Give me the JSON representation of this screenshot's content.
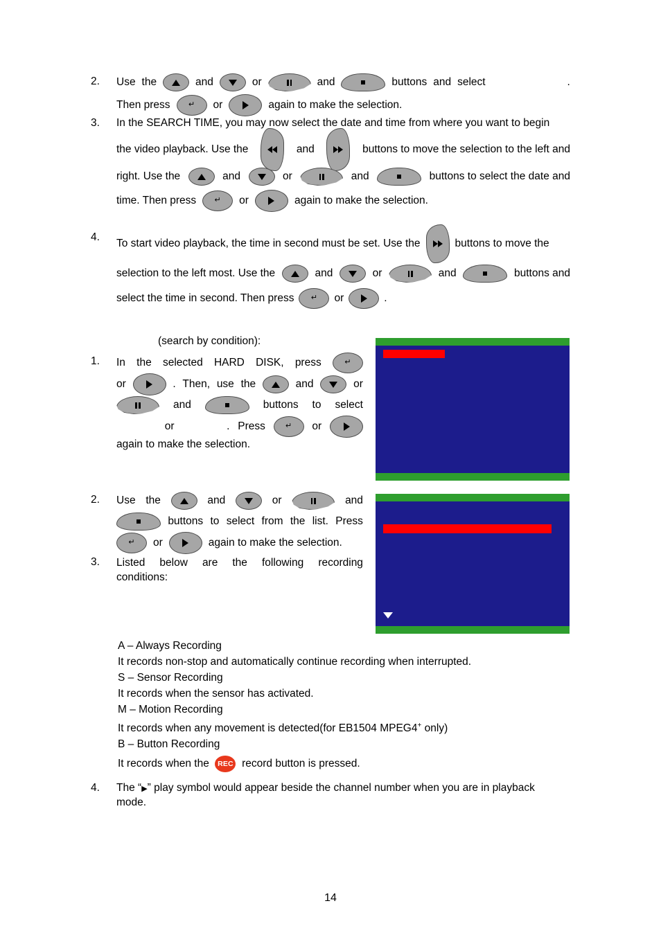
{
  "document": {
    "page_number": "14"
  },
  "colors": {
    "button_face": "#a6a6a6",
    "button_edge": "#4d4d4d",
    "screen_blue": "#1c1c8c",
    "screen_green": "#2e9e2e",
    "screen_red": "#ff0000",
    "rec_red": "#e8381c"
  },
  "icons": {
    "up": "▲",
    "down": "▼",
    "right": "▶",
    "enter": "↵",
    "pause": "❚❚",
    "stop": "■",
    "rewind": "◀◀",
    "forward": "▶▶",
    "rec_label": "REC"
  },
  "section_top": {
    "item2": {
      "number": "2.",
      "l1_a": "Use",
      "l1_b": "the",
      "l1_c": "and",
      "l1_d": "or",
      "l1_e": "and",
      "l1_f": "buttons",
      "l1_g": "and",
      "l1_h": "select",
      "l1_i": ".",
      "l2_a": "Then press",
      "l2_b": "or",
      "l2_c": "again to make the selection."
    },
    "item3": {
      "number": "3.",
      "l1": "In the SEARCH TIME, you may now select the date and time from where you want to begin",
      "l2_a": "the video playback. Use the",
      "l2_b": "and",
      "l2_c": "buttons to move the selection to the left and",
      "l3_a": "right. Use the",
      "l3_b": "and",
      "l3_c": "or",
      "l3_d": "and",
      "l3_e": "buttons to select the date and",
      "l4_a": "time. Then press",
      "l4_b": "or",
      "l4_c": "again to make the selection."
    },
    "item4": {
      "number": "4.",
      "l1_a": "To start video playback, the time in second must be set. Use the",
      "l1_b": "buttons to move the",
      "l2_a": "selection to the left most. Use the",
      "l2_b": "and",
      "l2_c": "or",
      "l2_d": "and",
      "l2_e": "buttons and",
      "l3_a": "select the time in second. Then press",
      "l3_b": "or",
      "l3_c": "."
    }
  },
  "section_mid": {
    "heading": "(search by condition):",
    "item1": {
      "number": "1.",
      "l1_a": "In",
      "l1_b": "the",
      "l1_c": "selected",
      "l1_d": "HARD",
      "l1_e": "DISK,",
      "l1_f": "press",
      "l2_a": "or",
      "l2_b": ".",
      "l2_c": "Then,",
      "l2_d": "use",
      "l2_e": "the",
      "l2_f": "and",
      "l2_g": "or",
      "l3_a": "and",
      "l3_b": "buttons",
      "l3_c": "to",
      "l3_d": "select",
      "l4_a": "or",
      "l4_b": ".",
      "l4_c": "Press",
      "l4_d": "or",
      "l5": "again to make the selection."
    },
    "item2": {
      "number": "2.",
      "l1_a": "Use",
      "l1_b": "the",
      "l1_c": "and",
      "l1_d": "or",
      "l1_e": "and",
      "l2_a": "buttons",
      "l2_b": "to",
      "l2_c": "select",
      "l2_d": "from",
      "l2_e": "the",
      "l2_f": "list.",
      "l2_g": "Press",
      "l3_a": "or",
      "l3_b": "again to make the selection."
    },
    "item3": {
      "number": "3.",
      "l1_a": "Listed",
      "l1_b": "below",
      "l1_c": "are",
      "l1_d": "the",
      "l1_e": "following",
      "l1_f": "recording",
      "l2": "conditions:"
    }
  },
  "conditions": [
    "A – Always Recording",
    "It records non-stop and automatically continue recording when interrupted.",
    "S – Sensor Recording",
    "It records when the sensor has activated.",
    "M – Motion Recording",
    "B – Button Recording"
  ],
  "condition_motion_detail": {
    "before": "It records when any movement is detected(for EB1504 MPEG4",
    "sup": "+",
    "after": " only)"
  },
  "condition_button_detail": {
    "before": "It records when the",
    "after": "record button is pressed."
  },
  "section_bottom": {
    "item4": {
      "number": "4.",
      "l1_a": "The “",
      "l1_sym": "▶",
      "l1_b": "” play symbol would appear beside the channel number when you are in playback",
      "l2": "mode."
    }
  }
}
